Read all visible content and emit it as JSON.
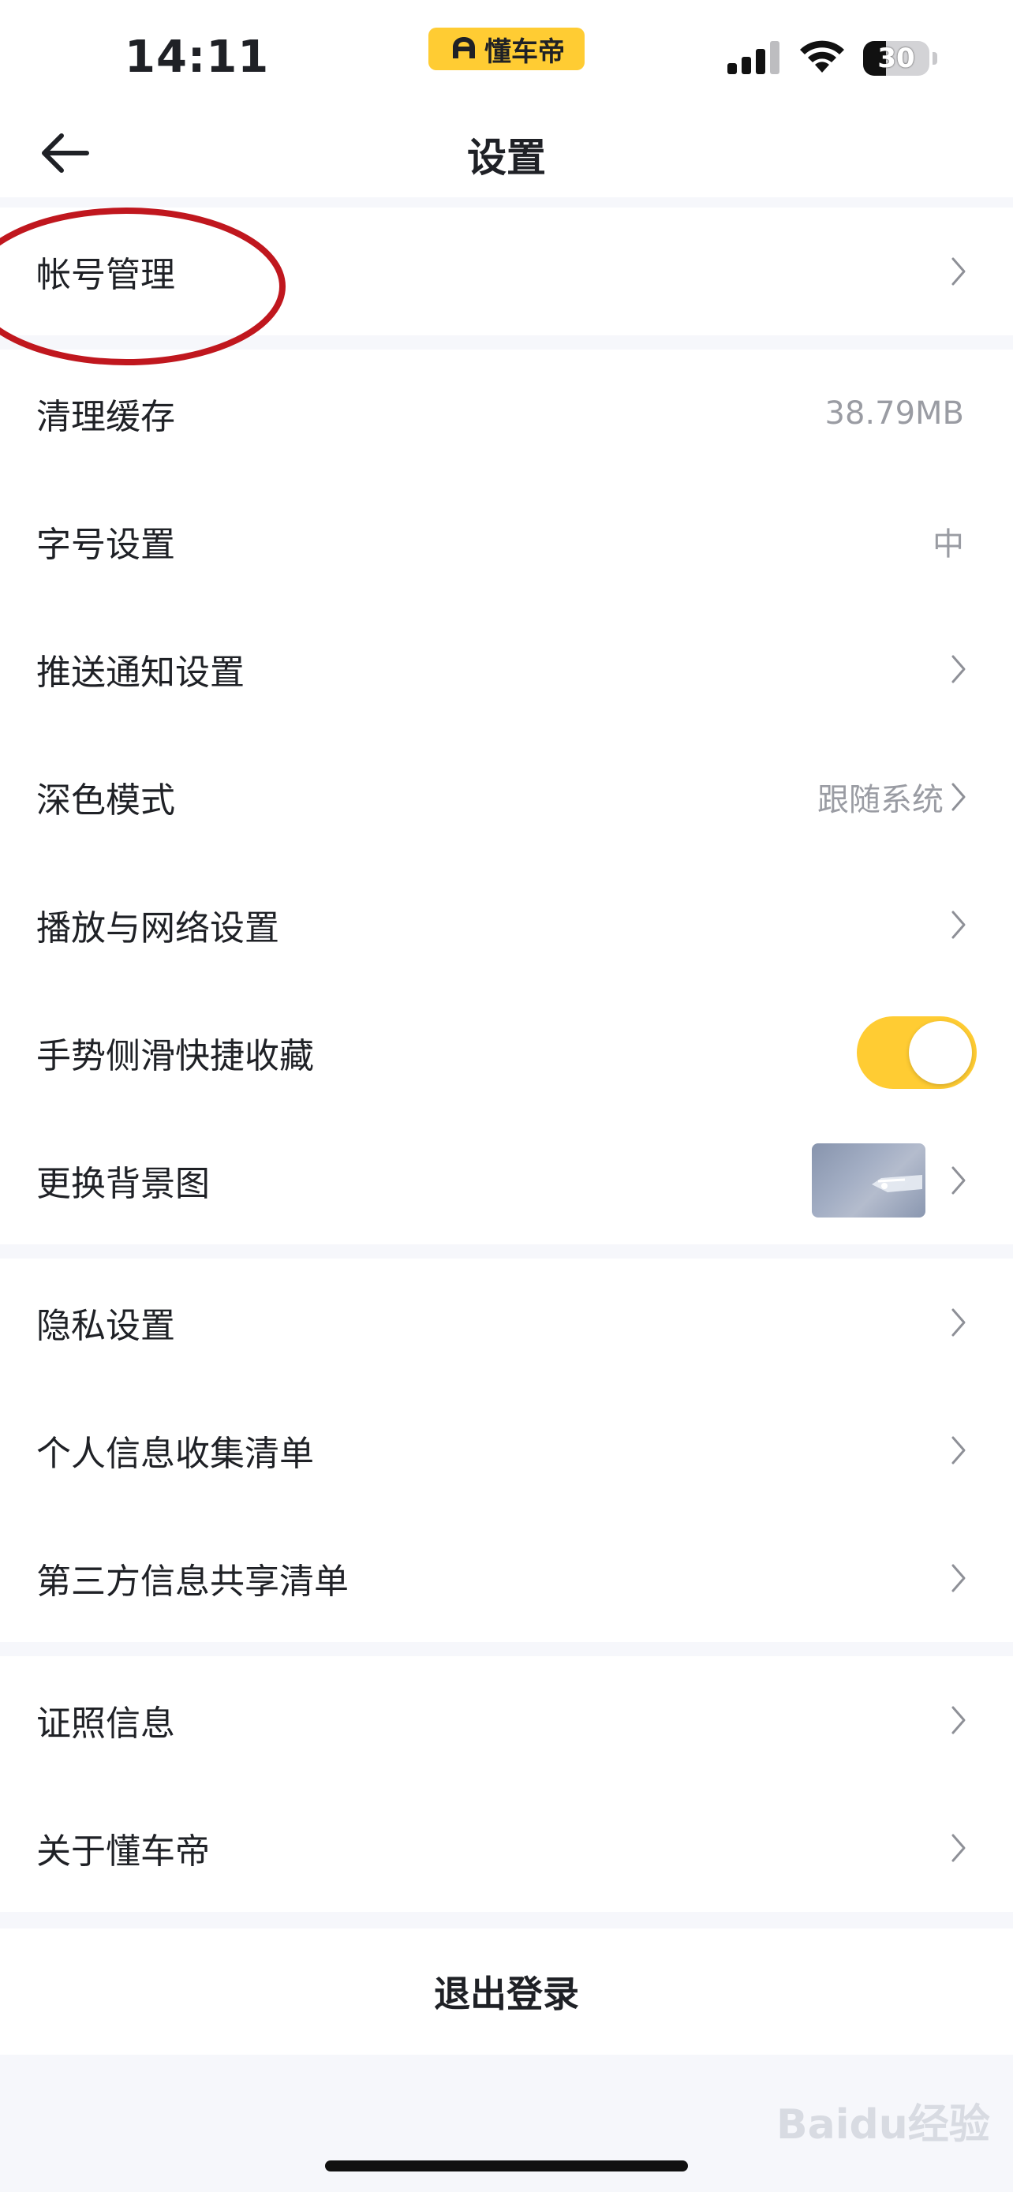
{
  "status_bar": {
    "time": "14:11",
    "app_badge": "懂车帝",
    "battery": "30",
    "icons": [
      "cellular-signal-icon",
      "wifi-icon",
      "battery-icon"
    ]
  },
  "nav": {
    "title": "设置",
    "back_icon": "arrow-left-icon"
  },
  "groups": [
    {
      "items": [
        {
          "label": "帐号管理",
          "value": "",
          "chevron": true
        }
      ]
    },
    {
      "items": [
        {
          "label": "清理缓存",
          "value": "38.79MB",
          "chevron": false
        },
        {
          "label": "字号设置",
          "value": "中",
          "chevron": false
        },
        {
          "label": "推送通知设置",
          "value": "",
          "chevron": true
        },
        {
          "label": "深色模式",
          "value": "跟随系统",
          "chevron": true
        },
        {
          "label": "播放与网络设置",
          "value": "",
          "chevron": true
        },
        {
          "label": "手势侧滑快捷收藏",
          "toggle": true,
          "toggle_on": true
        },
        {
          "label": "更换背景图",
          "thumbnail": true,
          "chevron": true
        }
      ]
    },
    {
      "items": [
        {
          "label": "隐私设置",
          "value": "",
          "chevron": true
        },
        {
          "label": "个人信息收集清单",
          "value": "",
          "chevron": true
        },
        {
          "label": "第三方信息共享清单",
          "value": "",
          "chevron": true
        }
      ]
    },
    {
      "items": [
        {
          "label": "证照信息",
          "value": "",
          "chevron": true
        },
        {
          "label": "关于懂车帝",
          "value": "",
          "chevron": true
        }
      ]
    }
  ],
  "logout_label": "退出登录",
  "colors": {
    "accent": "#ffcc33",
    "annotation": "#c0171e",
    "background": "#f6f7fb",
    "secondary_text": "#9a9ca3"
  },
  "watermark": "Baidu经验"
}
